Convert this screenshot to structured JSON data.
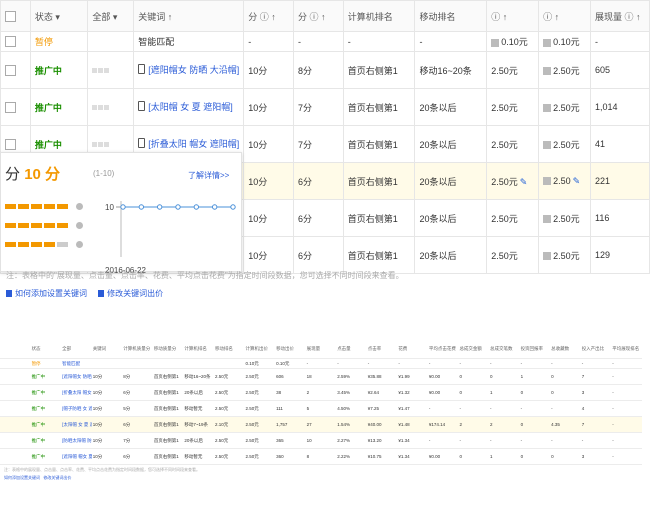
{
  "main": {
    "columns": [
      "状态",
      "全部",
      "关键词",
      "分",
      "分",
      "计算机排名",
      "移动排名",
      "",
      "",
      "展现量"
    ],
    "rows": [
      {
        "status": "暂停",
        "kw": "智能匹配",
        "c1": "-",
        "c2": "-",
        "pc": "-",
        "mob": "-",
        "bid1": "0.10元",
        "bid2": "0.10元",
        "imp": "-"
      },
      {
        "status": "推广中",
        "kw": "[遮阳帽女 防晒 大沿帽]",
        "c1": "10分",
        "c2": "8分",
        "pc": "首页右侧第1",
        "mob": "移动16~20条",
        "bid1": "2.50元",
        "bid2": "2.50元",
        "imp": "605"
      },
      {
        "status": "推广中",
        "kw": "[太阳帽 女 夏 遮阳帽]",
        "c1": "10分",
        "c2": "7分",
        "pc": "首页右侧第1",
        "mob": "20条以后",
        "bid1": "2.50元",
        "bid2": "2.50元",
        "imp": "1,014"
      },
      {
        "status": "推广中",
        "kw": "[折叠太阳 帽女 遮阳帽]",
        "c1": "10分",
        "c2": "7分",
        "pc": "首页右侧第1",
        "mob": "20条以后",
        "bid1": "2.50元",
        "bid2": "2.50元",
        "imp": "41"
      },
      {
        "status": "",
        "kw": "",
        "c1": "10分",
        "c2": "6分",
        "pc": "首页右侧第1",
        "mob": "20条以后",
        "bid1": "2.50元",
        "bid2": "2.50",
        "imp": "221"
      },
      {
        "status": "",
        "kw": "",
        "c1": "10分",
        "c2": "6分",
        "pc": "首页右侧第1",
        "mob": "20条以后",
        "bid1": "2.50元",
        "bid2": "2.50元",
        "imp": "116"
      },
      {
        "status": "",
        "kw": "",
        "c1": "10分",
        "c2": "6分",
        "pc": "首页右侧第1",
        "mob": "20条以后",
        "bid1": "2.50元",
        "bid2": "2.50元",
        "imp": "129"
      }
    ],
    "note": "注：表格中的\"展现量、点击量、点击率、花费、平均点击花费\"为指定时间段数据，您可选择不同时间段来查看。",
    "link1": "如何添加设置关键词",
    "link2": "修改关键词出价"
  },
  "popup": {
    "score_prefix": "分",
    "score_value": "10 分",
    "range": "(1-10)",
    "link": "了解详情>>",
    "chart_y": "10",
    "chart_date": "2016-06-22"
  },
  "chart_data": {
    "type": "line",
    "x": [
      "",
      "",
      "",
      "",
      "",
      "",
      "2016-06-22"
    ],
    "series": [
      {
        "values": [
          10,
          10,
          10,
          10,
          10,
          10,
          10
        ]
      }
    ],
    "title": "",
    "xlabel": "",
    "ylabel": ""
  },
  "small": {
    "columns": [
      "状态",
      "全部",
      "关键词",
      "计算机质量分",
      "移动质量分",
      "计算机排名",
      "移动排名",
      "计算机出价",
      "移动出价",
      "展现量",
      "点击量",
      "点击率",
      "花费",
      "平均点击花费",
      "总成交金额",
      "总成交笔数",
      "投资回报率",
      "总收藏数",
      "投入产出比",
      "平均展现排名"
    ],
    "rows": [
      [
        "暂停",
        "智能匹配",
        "",
        "",
        "",
        "",
        "",
        "0.10元",
        "0.10元",
        "-",
        "-",
        "-",
        "-",
        "-",
        "-",
        "-",
        "-",
        "-",
        "-",
        "-"
      ],
      [
        "推广中",
        "[遮阳帽女 防晒 大沿帽]",
        "10分",
        "8分",
        "首页右侧第1",
        "移动16~20条",
        "2.50元",
        "2.50元",
        "606",
        "18",
        "2.59%",
        "¥35.88",
        "¥1.99",
        "¥0.00",
        "0",
        "0",
        "1",
        "0",
        "7",
        "-"
      ],
      [
        "推广中",
        "[折叠太阳 帽女 遮阳帽]",
        "10分",
        "6分",
        "首页右侧第1",
        "20条以后",
        "2.50元",
        "2.50元",
        "38",
        "2",
        "3.45%",
        "¥2.64",
        "¥1.32",
        "¥0.00",
        "0",
        "1",
        "0",
        "0",
        "3",
        "-"
      ],
      [
        "推广中",
        "[帽子防晒 女 遮阳帽]",
        "10分",
        "5分",
        "首页右侧第1",
        "移动暂无",
        "2.50元",
        "2.50元",
        "111",
        "5",
        "4.50%",
        "¥7.25",
        "¥1.47",
        "-",
        "-",
        "-",
        "-",
        "-",
        "4",
        "-"
      ],
      [
        "推广中",
        "[太阳帽 女 夏 遮阳帽]",
        "10分",
        "6分",
        "首页右侧第1",
        "移动7~19条",
        "2.10元",
        "2.50元",
        "1,757",
        "27",
        "1.54%",
        "¥40.00",
        "¥1.48",
        "¥174.14",
        "2",
        "2",
        "0",
        "4.35",
        "7",
        "-"
      ],
      [
        "推广中",
        "[防晒太阳帽 防紫外线 女]",
        "10分",
        "7分",
        "首页右侧第1",
        "20条以后",
        "2.50元",
        "2.50元",
        "365",
        "10",
        "2.27%",
        "¥13.20",
        "¥1.34",
        "-",
        "-",
        "-",
        "-",
        "-",
        "-",
        "-"
      ],
      [
        "推广中",
        "[遮阳帽 帽女 夏]",
        "10分",
        "6分",
        "首页右侧第1",
        "移动暂无",
        "2.50元",
        "2.50元",
        "360",
        "8",
        "2.22%",
        "¥10.75",
        "¥1.34",
        "¥0.00",
        "0",
        "1",
        "0",
        "0",
        "3",
        "-"
      ]
    ],
    "note": "注：表格中的展现量、点击量、点击率、花费、平均点击花费为指定时间段数据，您可选择不同时间段来查看。",
    "link1": "如何添加设置关键词",
    "link2": "修改关键词出价"
  }
}
